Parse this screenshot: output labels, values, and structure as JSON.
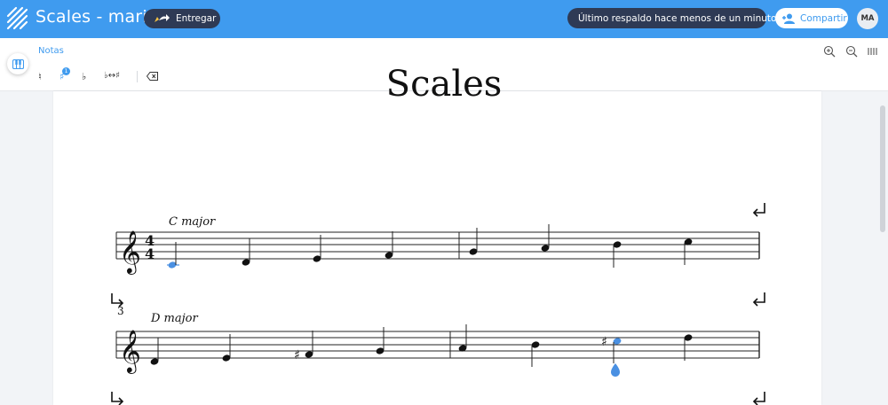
{
  "header": {
    "title": "Scales - mari",
    "submit_label": "Entregar",
    "backup_status": "Último respaldo hace menos de un minuto",
    "share_label": "Compartir",
    "avatar_initials": "MA",
    "bar_color": "#3f9bef"
  },
  "toolbar": {
    "tab_label": "Notas",
    "accidentals": [
      {
        "name": "natural",
        "glyph": "♮"
      },
      {
        "name": "sharp",
        "glyph": "♯",
        "badge": "1"
      },
      {
        "name": "flat",
        "glyph": "♭"
      },
      {
        "name": "flip-enharmonic",
        "glyph": "♭↔♯"
      }
    ]
  },
  "score": {
    "title": "Scales",
    "systems": [
      {
        "label": "C major",
        "measure_number": ""
      },
      {
        "label": "D major",
        "measure_number": "3"
      }
    ],
    "time_signature": {
      "top": "4",
      "bottom": "4"
    },
    "selection_color": "#4a90e2"
  }
}
